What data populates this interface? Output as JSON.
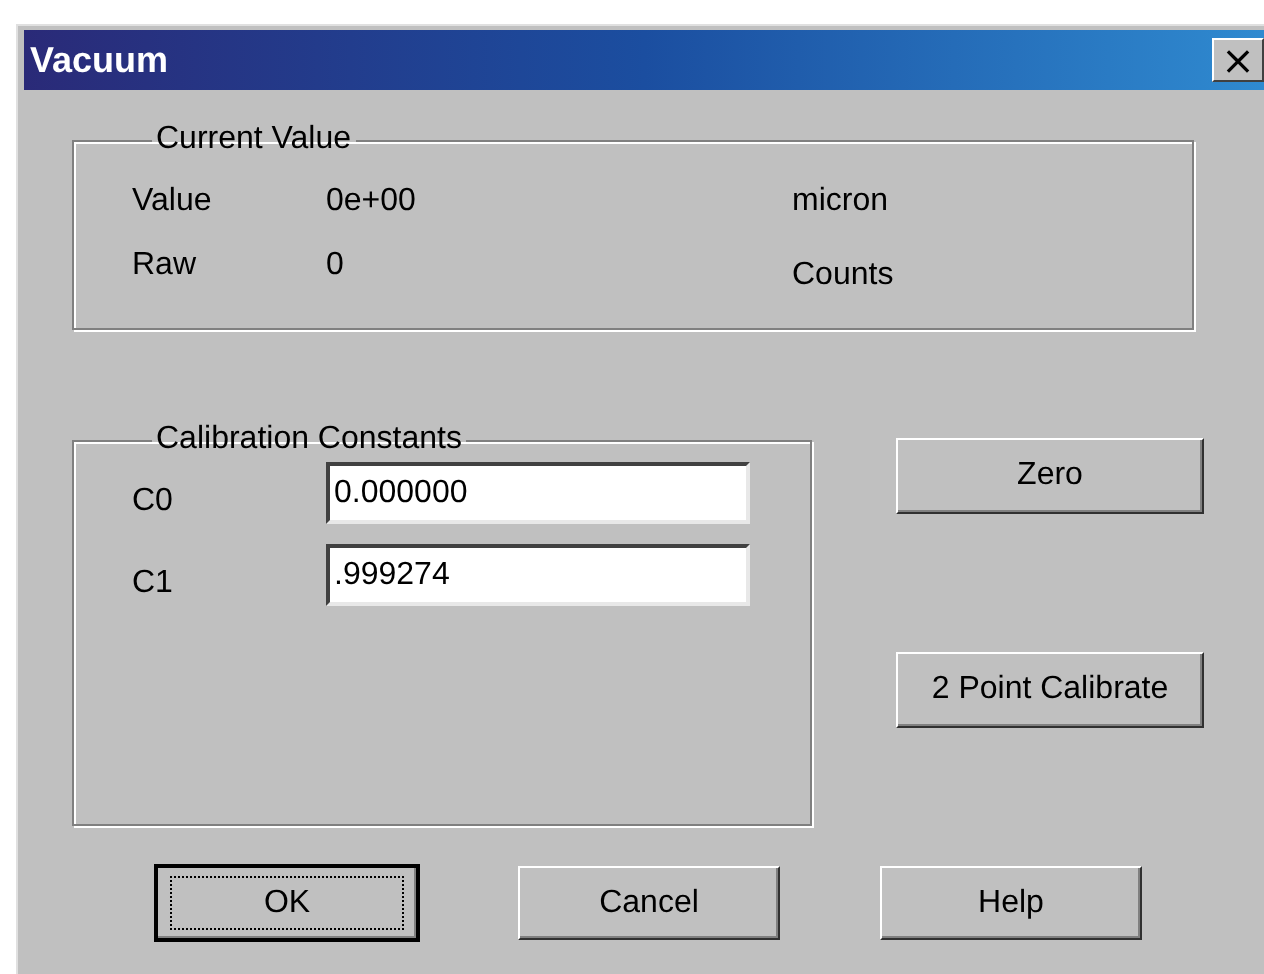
{
  "window": {
    "title": "Vacuum",
    "close_label": "×"
  },
  "current_value": {
    "title": "Current Value",
    "rows": [
      {
        "label": "Value",
        "value": "0e+00",
        "unit": "micron"
      },
      {
        "label": "Raw",
        "value": "0",
        "unit": "Counts"
      }
    ]
  },
  "calibration": {
    "title": "Calibration Constants",
    "fields": [
      {
        "label": "C0",
        "value": "0.000000"
      },
      {
        "label": "C1",
        "value": ".999274"
      }
    ]
  },
  "side_buttons": [
    "Zero",
    "2 Point Calibrate"
  ],
  "buttons": [
    {
      "label": "OK",
      "default": true
    },
    {
      "label": "Cancel",
      "default": false
    },
    {
      "label": "Help",
      "default": false
    }
  ]
}
